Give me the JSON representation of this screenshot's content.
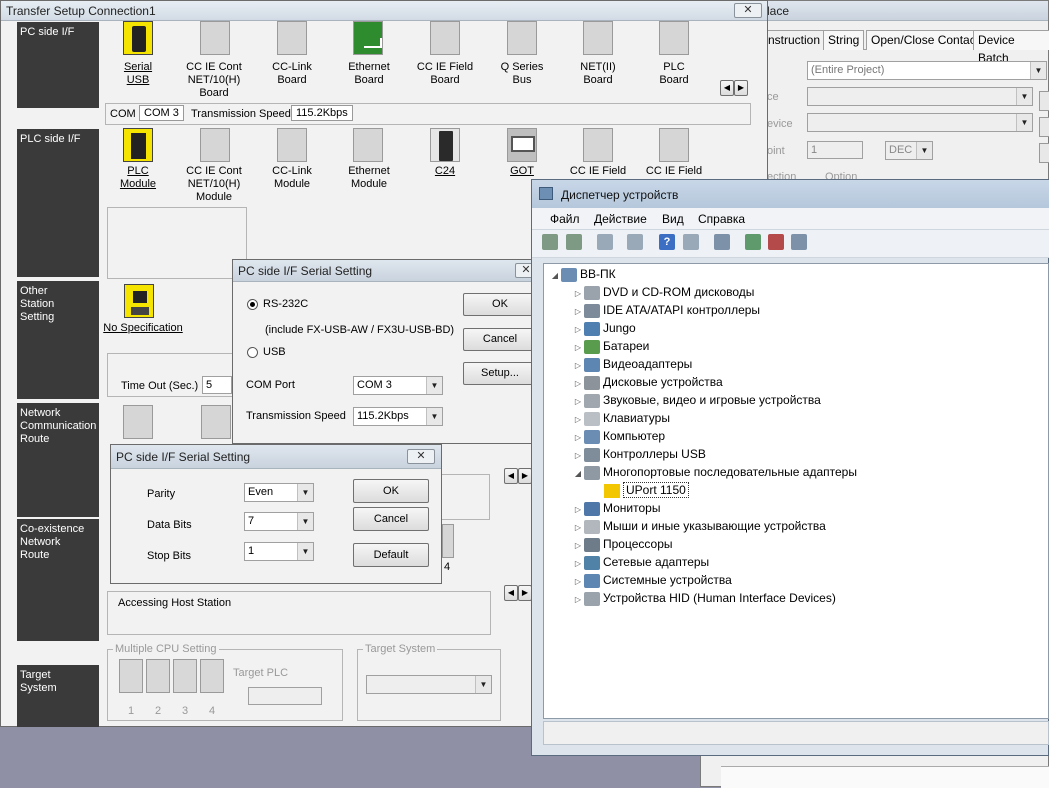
{
  "transfer_setup": {
    "title": "Transfer Setup Connection1",
    "side_labels": {
      "pc_if": "PC side I/F",
      "plc_if": "PLC side I/F",
      "other_station": "Other\nStation\nSetting",
      "network_route": "Network\nCommunication\nRoute",
      "coexistence": "Co-existence\nNetwork\nRoute",
      "target_system": "Target\nSystem"
    },
    "pc_if_items": [
      "Serial\nUSB",
      "CC IE Cont\nNET/10(H)\nBoard",
      "CC-Link\nBoard",
      "Ethernet\nBoard",
      "CC IE Field\nBoard",
      "Q Series\nBus",
      "NET(II)\nBoard",
      "PLC\nBoard"
    ],
    "status": {
      "com_label": "COM",
      "com_value": "COM 3",
      "speed_label": "Transmission Speed",
      "speed_value": "115.2Kbps"
    },
    "plc_if_items": [
      "PLC\nModule",
      "CC IE Cont\nNET/10(H)\nModule",
      "CC-Link\nModule",
      "Ethernet\nModule",
      "C24",
      "GOT",
      "CC IE Field",
      "CC IE Field"
    ],
    "no_spec": "No Specification",
    "timeout_label": "Time Out (Sec.)",
    "timeout_value": "5",
    "accessing_host": "Accessing Host Station",
    "multiple_cpu": "Multiple CPU Setting",
    "target_plc": "Target PLC",
    "cpu_numbers": [
      "1",
      "2",
      "3",
      "4"
    ],
    "target_system_group": "Target System",
    "partial_label": "4"
  },
  "bg_window": {
    "title_suffix": "lace",
    "tabs": [
      "nstruction",
      "String",
      "Open/Close Contact",
      "Device Batch"
    ],
    "scope_value": "(Entire Project)",
    "row_labels": [
      "ce",
      "evice",
      "oint",
      "ection"
    ],
    "point_value": "1",
    "radix_value": "DEC",
    "option_label": "Option"
  },
  "serial_dialog1": {
    "title": "PC side I/F Serial Setting",
    "rs232": "RS-232C",
    "rs232_note": "(include FX-USB-AW / FX3U-USB-BD)",
    "usb": "USB",
    "com_port_label": "COM Port",
    "com_port_value": "COM 3",
    "speed_label": "Transmission Speed",
    "speed_value": "115.2Kbps",
    "ok": "OK",
    "cancel": "Cancel",
    "setup": "Setup..."
  },
  "serial_dialog2": {
    "title": "PC side I/F Serial Setting",
    "parity_label": "Parity",
    "parity_value": "Even",
    "databits_label": "Data Bits",
    "databits_value": "7",
    "stopbits_label": "Stop Bits",
    "stopbits_value": "1",
    "ok": "OK",
    "cancel": "Cancel",
    "default": "Default"
  },
  "device_manager": {
    "title": "Диспетчер устройств",
    "menu": [
      "Файл",
      "Действие",
      "Вид",
      "Справка"
    ],
    "root": "ВВ-ПК",
    "items": [
      "DVD и CD-ROM дисководы",
      "IDE ATA/ATAPI контроллеры",
      "Jungo",
      "Батареи",
      "Видеоадаптеры",
      "Дисковые устройства",
      "Звуковые, видео и игровые устройства",
      "Клавиатуры",
      "Компьютер",
      "Контроллеры USB",
      "Многопортовые последовательные адаптеры",
      "UPort 1150",
      "Мониторы",
      "Мыши и иные указывающие устройства",
      "Процессоры",
      "Сетевые адаптеры",
      "Системные устройства",
      "Устройства HID (Human Interface Devices)"
    ]
  }
}
